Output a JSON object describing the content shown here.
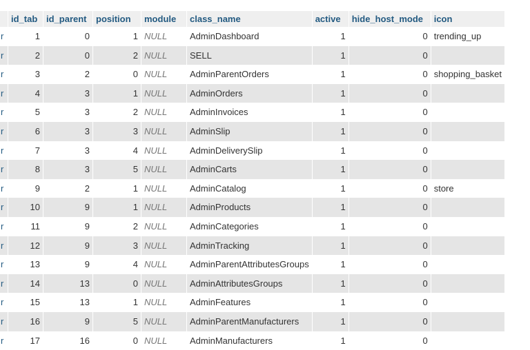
{
  "table": {
    "columns": {
      "id_tab": "id_tab",
      "id_parent": "id_parent",
      "position": "position",
      "module": "module",
      "class_name": "class_name",
      "active": "active",
      "hide_host_mode": "hide_host_mode",
      "icon": "icon"
    },
    "row_marker": "r",
    "rows": [
      {
        "id_tab": "1",
        "id_parent": "0",
        "position": "1",
        "module": "NULL",
        "class_name": "AdminDashboard",
        "active": "1",
        "hide_host_mode": "0",
        "icon": "trending_up"
      },
      {
        "id_tab": "2",
        "id_parent": "0",
        "position": "2",
        "module": "NULL",
        "class_name": "SELL",
        "active": "1",
        "hide_host_mode": "0",
        "icon": ""
      },
      {
        "id_tab": "3",
        "id_parent": "2",
        "position": "0",
        "module": "NULL",
        "class_name": "AdminParentOrders",
        "active": "1",
        "hide_host_mode": "0",
        "icon": "shopping_basket"
      },
      {
        "id_tab": "4",
        "id_parent": "3",
        "position": "1",
        "module": "NULL",
        "class_name": "AdminOrders",
        "active": "1",
        "hide_host_mode": "0",
        "icon": ""
      },
      {
        "id_tab": "5",
        "id_parent": "3",
        "position": "2",
        "module": "NULL",
        "class_name": "AdminInvoices",
        "active": "1",
        "hide_host_mode": "0",
        "icon": ""
      },
      {
        "id_tab": "6",
        "id_parent": "3",
        "position": "3",
        "module": "NULL",
        "class_name": "AdminSlip",
        "active": "1",
        "hide_host_mode": "0",
        "icon": ""
      },
      {
        "id_tab": "7",
        "id_parent": "3",
        "position": "4",
        "module": "NULL",
        "class_name": "AdminDeliverySlip",
        "active": "1",
        "hide_host_mode": "0",
        "icon": ""
      },
      {
        "id_tab": "8",
        "id_parent": "3",
        "position": "5",
        "module": "NULL",
        "class_name": "AdminCarts",
        "active": "1",
        "hide_host_mode": "0",
        "icon": ""
      },
      {
        "id_tab": "9",
        "id_parent": "2",
        "position": "1",
        "module": "NULL",
        "class_name": "AdminCatalog",
        "active": "1",
        "hide_host_mode": "0",
        "icon": "store"
      },
      {
        "id_tab": "10",
        "id_parent": "9",
        "position": "1",
        "module": "NULL",
        "class_name": "AdminProducts",
        "active": "1",
        "hide_host_mode": "0",
        "icon": ""
      },
      {
        "id_tab": "11",
        "id_parent": "9",
        "position": "2",
        "module": "NULL",
        "class_name": "AdminCategories",
        "active": "1",
        "hide_host_mode": "0",
        "icon": ""
      },
      {
        "id_tab": "12",
        "id_parent": "9",
        "position": "3",
        "module": "NULL",
        "class_name": "AdminTracking",
        "active": "1",
        "hide_host_mode": "0",
        "icon": ""
      },
      {
        "id_tab": "13",
        "id_parent": "9",
        "position": "4",
        "module": "NULL",
        "class_name": "AdminParentAttributesGroups",
        "active": "1",
        "hide_host_mode": "0",
        "icon": ""
      },
      {
        "id_tab": "14",
        "id_parent": "13",
        "position": "0",
        "module": "NULL",
        "class_name": "AdminAttributesGroups",
        "active": "1",
        "hide_host_mode": "0",
        "icon": ""
      },
      {
        "id_tab": "15",
        "id_parent": "13",
        "position": "1",
        "module": "NULL",
        "class_name": "AdminFeatures",
        "active": "1",
        "hide_host_mode": "0",
        "icon": ""
      },
      {
        "id_tab": "16",
        "id_parent": "9",
        "position": "5",
        "module": "NULL",
        "class_name": "AdminParentManufacturers",
        "active": "1",
        "hide_host_mode": "0",
        "icon": ""
      },
      {
        "id_tab": "17",
        "id_parent": "16",
        "position": "0",
        "module": "NULL",
        "class_name": "AdminManufacturers",
        "active": "1",
        "hide_host_mode": "0",
        "icon": ""
      }
    ]
  }
}
